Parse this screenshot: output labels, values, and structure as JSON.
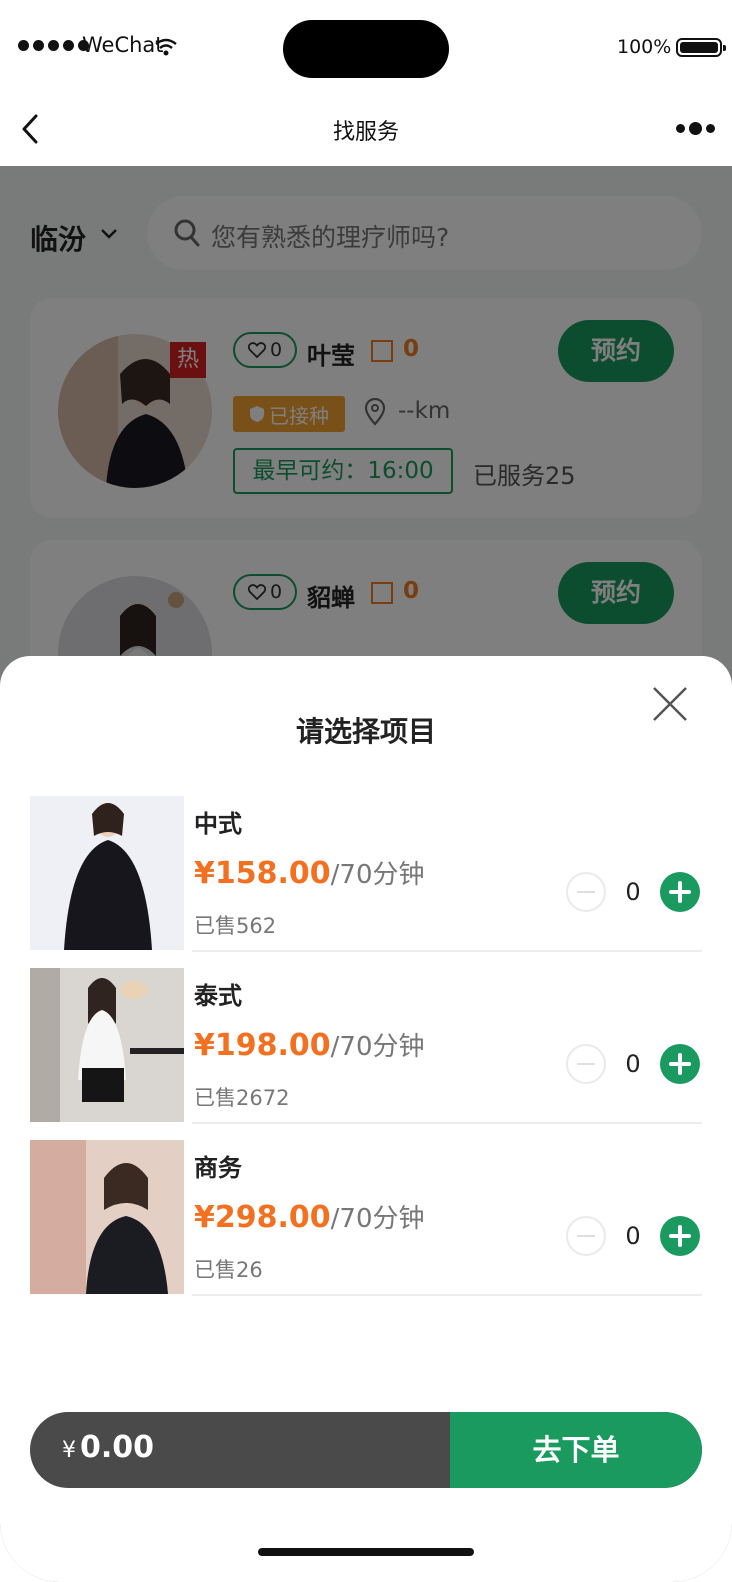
{
  "status_bar": {
    "carrier": "WeChat",
    "battery": "100%"
  },
  "nav": {
    "title": "找服务"
  },
  "filter": {
    "city": "临汾",
    "search_placeholder": "您有熟悉的理疗师吗?"
  },
  "therapists": [
    {
      "hot_badge": "热",
      "likes": "0",
      "name": "叶莹",
      "rating": "0",
      "book_label": "预约",
      "vaccinated": "已接种",
      "distance": "--km",
      "earliest": "最早可约：16:00",
      "served": "已服务25"
    },
    {
      "likes": "0",
      "name": "貂蝉",
      "rating": "0",
      "book_label": "预约"
    }
  ],
  "sheet": {
    "title": "请选择项目",
    "items": [
      {
        "name": "中式",
        "currency": "¥",
        "price": "158.00",
        "duration": "/70分钟",
        "sold": "已售562",
        "qty": "0"
      },
      {
        "name": "泰式",
        "currency": "¥",
        "price": "198.00",
        "duration": "/70分钟",
        "sold": "已售2672",
        "qty": "0"
      },
      {
        "name": "商务",
        "currency": "¥",
        "price": "298.00",
        "duration": "/70分钟",
        "sold": "已售26",
        "qty": "0"
      }
    ],
    "cart": {
      "currency": "¥",
      "total": "0.00",
      "checkout_label": "去下单"
    }
  },
  "colors": {
    "accent": "#1a9a5f",
    "price": "#f37021",
    "hot": "#d62020",
    "badge": "#f3a02f"
  }
}
